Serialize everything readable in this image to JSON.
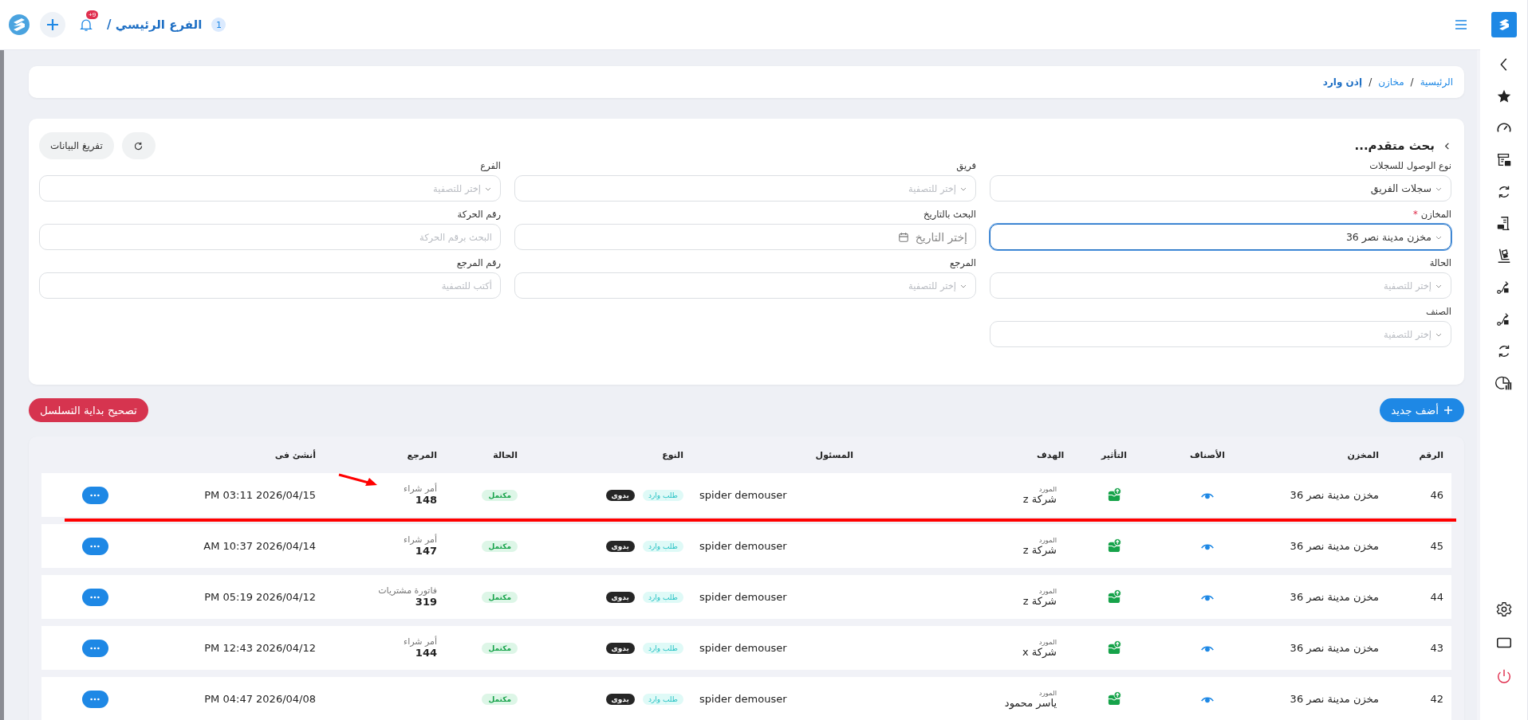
{
  "topbar": {
    "branch_count": "1",
    "branch": "الفرع الرئيسي /",
    "notifications": "+9"
  },
  "breadcrumb_separator": "/",
  "breadcrumb": [
    {
      "label": "الرئيسية",
      "current": false
    },
    {
      "label": "مخازن",
      "current": false
    },
    {
      "label": "إذن وارد",
      "current": true
    }
  ],
  "filters": {
    "title": "بحث متقدم...",
    "expanded": true,
    "clear_button": "تفريغ البيانات",
    "required_mark": "*",
    "fields": [
      {
        "label": "نوع الوصول للسجلات",
        "kind": "select",
        "value": "سجلات الفريق",
        "required": false,
        "focused": false
      },
      {
        "label": "فريق",
        "kind": "select",
        "placeholder": "إختر للتصفية",
        "required": false,
        "focused": false
      },
      {
        "label": "الفرع",
        "kind": "select",
        "placeholder": "إختر للتصفية",
        "required": false,
        "focused": false
      },
      {
        "label": "المخازن",
        "kind": "select",
        "value": "مخزن مدينة نصر 36",
        "required": true,
        "focused": true
      },
      {
        "label": "البحث بالتاريخ",
        "kind": "date",
        "placeholder": "إختر التاريخ",
        "required": false,
        "focused": false
      },
      {
        "label": "رقم الحركة",
        "kind": "text",
        "placeholder": "البحث برقم الحركة",
        "required": false,
        "focused": false
      },
      {
        "label": "الحالة",
        "kind": "select",
        "placeholder": "إختر للتصفية",
        "required": false,
        "focused": false
      },
      {
        "label": "المرجع",
        "kind": "select",
        "placeholder": "إختر للتصفية",
        "required": false,
        "focused": false
      },
      {
        "label": "رقم المرجع",
        "kind": "text",
        "placeholder": "أكتب للتصفية",
        "required": false,
        "focused": false
      },
      {
        "label": "الصنف",
        "kind": "select",
        "placeholder": "إختر للتصفية",
        "required": false,
        "focused": false
      }
    ]
  },
  "actions": {
    "add": "أضف جديد",
    "fix_sequence": "تصحيح بداية التسلسل"
  },
  "table": {
    "columns": [
      "الرقم",
      "المخزن",
      "الأصناف",
      "التأثير",
      "الهدف",
      "المسئول",
      "النوع",
      "الحالة",
      "المرجع",
      "أنشئ فى"
    ],
    "rows": [
      {
        "number": "46",
        "store": "مخزن مدينة نصر 36",
        "target_label": "المورد",
        "target": "شركة z",
        "responsible": "spider demouser",
        "types": [
          {
            "label": "طلب وارد",
            "kind": "request"
          },
          {
            "label": "يدوى",
            "kind": "manual"
          }
        ],
        "status": {
          "label": "مكتمل",
          "kind": "success"
        },
        "ref_label": "أمر شراء",
        "ref": "148",
        "created": "PM 03:11 2026/04/15",
        "marked": true
      },
      {
        "number": "45",
        "store": "مخزن مدينة نصر 36",
        "target_label": "المورد",
        "target": "شركة z",
        "responsible": "spider demouser",
        "types": [
          {
            "label": "طلب وارد",
            "kind": "request"
          },
          {
            "label": "يدوى",
            "kind": "manual"
          }
        ],
        "status": {
          "label": "مكتمل",
          "kind": "success"
        },
        "ref_label": "أمر شراء",
        "ref": "147",
        "created": "AM 10:37 2026/04/14",
        "marked": false
      },
      {
        "number": "44",
        "store": "مخزن مدينة نصر 36",
        "target_label": "المورد",
        "target": "شركة z",
        "responsible": "spider demouser",
        "types": [
          {
            "label": "طلب وارد",
            "kind": "request"
          },
          {
            "label": "يدوى",
            "kind": "manual"
          }
        ],
        "status": {
          "label": "مكتمل",
          "kind": "success"
        },
        "ref_label": "فاتورة مشتريات",
        "ref": "319",
        "created": "PM 05:19 2026/04/12",
        "marked": false
      },
      {
        "number": "43",
        "store": "مخزن مدينة نصر 36",
        "target_label": "المورد",
        "target": "شركة x",
        "responsible": "spider demouser",
        "types": [
          {
            "label": "طلب وارد",
            "kind": "request"
          },
          {
            "label": "يدوى",
            "kind": "manual"
          }
        ],
        "status": {
          "label": "مكتمل",
          "kind": "success"
        },
        "ref_label": "أمر شراء",
        "ref": "144",
        "created": "PM 12:43 2026/04/12",
        "marked": false
      },
      {
        "number": "42",
        "store": "مخزن مدينة نصر 36",
        "target_label": "المورد",
        "target": "ياسر محمود",
        "responsible": "spider demouser",
        "types": [
          {
            "label": "طلب وارد",
            "kind": "request"
          },
          {
            "label": "يدوى",
            "kind": "manual"
          }
        ],
        "status": {
          "label": "مكتمل",
          "kind": "success"
        },
        "created": "PM 04:47 2026/04/08",
        "marked": false
      }
    ]
  }
}
